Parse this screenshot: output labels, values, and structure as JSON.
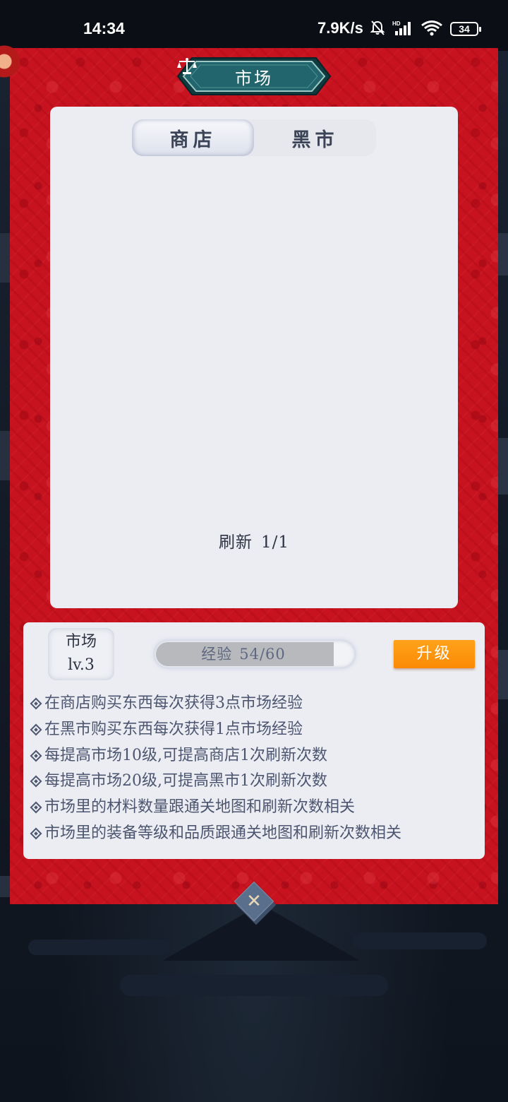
{
  "status_bar": {
    "time": "14:34",
    "net_speed": "7.9K/s",
    "battery": "34"
  },
  "dialog": {
    "title": "市场",
    "title_icon": "scale-icon",
    "tabs": [
      {
        "label": "商店",
        "active": true
      },
      {
        "label": "黑市",
        "active": false
      }
    ],
    "refresh": {
      "label": "刷新",
      "count": "1/1"
    }
  },
  "market": {
    "name": "市场",
    "level": "lv.3",
    "exp_label": "经验",
    "exp_value": "54/60",
    "exp_progress": 0.9,
    "upgrade_label": "升级",
    "tips": [
      "在商店购买东西每次获得3点市场经验",
      "在黑市购买东西每次获得1点市场经验",
      "每提高市场10级,可提高商店1次刷新次数",
      "每提高市场20级,可提高黑市1次刷新次数",
      "市场里的材料数量跟通关地图和刷新次数相关",
      "市场里的装备等级和品质跟通关地图和刷新次数相关"
    ]
  },
  "colors": {
    "dialog_red": "#c7121f",
    "panel": "#ecedf2",
    "banner": "#1f5a62",
    "upgrade": "#fb8a05",
    "text": "#4d5670"
  }
}
